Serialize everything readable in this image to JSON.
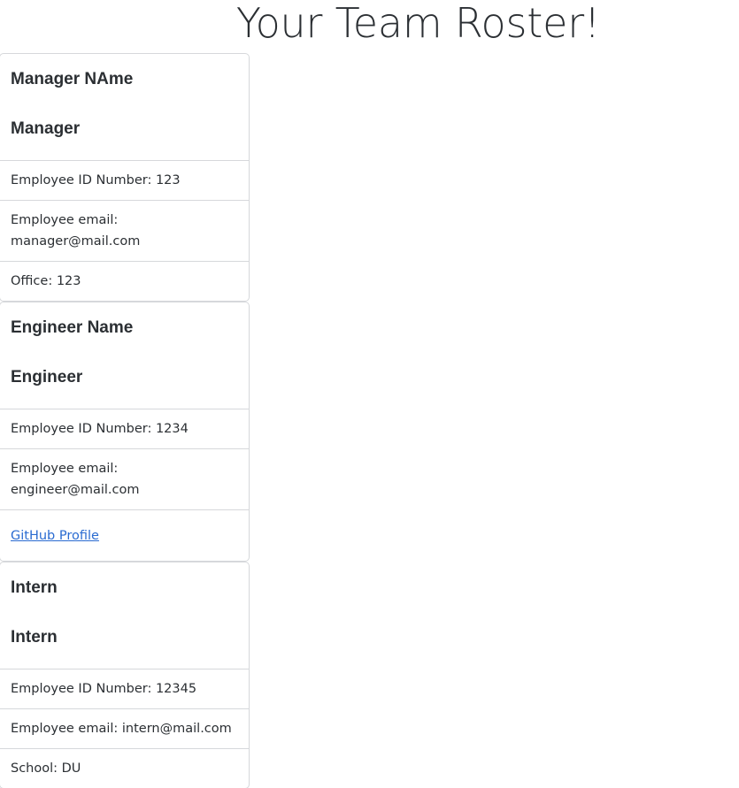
{
  "header": {
    "title": "Your Team Roster!"
  },
  "cards": [
    {
      "name": "Manager NAme",
      "role": "Manager",
      "id_text": "Employee ID Number: 123",
      "email_text": "Employee email: manager@mail.com",
      "extra_text": "Office: 123"
    },
    {
      "name": "Engineer Name",
      "role": "Engineer",
      "id_text": "Employee ID Number: 1234",
      "email_text": "Employee email: engineer@mail.com",
      "extra_link": "GitHub Profile"
    },
    {
      "name": "Intern",
      "role": "Intern",
      "id_text": "Employee ID Number: 12345",
      "email_text": "Employee email: intern@mail.com",
      "extra_text": "School: DU"
    }
  ],
  "colors": {
    "link": "#2a6bd1",
    "border": "#d6d8db",
    "text": "#2b2f33"
  }
}
